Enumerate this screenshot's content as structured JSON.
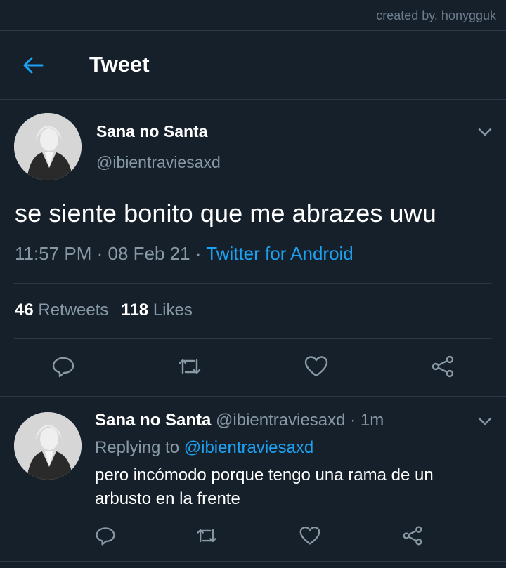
{
  "credit": "created by. honygguk",
  "header": {
    "title": "Tweet"
  },
  "tweet": {
    "name": "Sana no Santa",
    "handle": "@ibientraviesaxd",
    "text": "se siente bonito que me abrazes uwu",
    "time": "11:57 PM",
    "date": "08 Feb 21",
    "source": "Twitter for Android",
    "retweets": "46",
    "retweets_label": "Retweets",
    "likes": "118",
    "likes_label": "Likes"
  },
  "reply": {
    "name": "Sana no Santa",
    "handle": "@ibientraviesaxd",
    "age": "1m",
    "replying_label": "Replying to",
    "replying_handle": "@ibientraviesaxd",
    "text": "pero incómodo porque tengo una rama de un arbusto en la frente"
  },
  "colors": {
    "background": "#15202b",
    "accent": "#1da1f2",
    "muted": "#8899a6"
  },
  "icons": [
    "back-arrow-icon",
    "chevron-down-icon",
    "reply-icon",
    "retweet-icon",
    "like-icon",
    "share-icon"
  ]
}
